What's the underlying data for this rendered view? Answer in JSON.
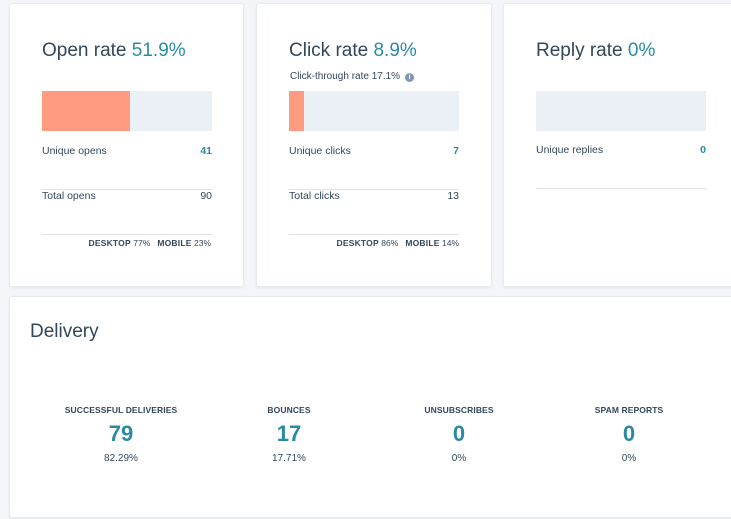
{
  "colors": {
    "accent": "#2b8aa3",
    "bar_fill": "#ff9b80",
    "bar_track": "#eaf0f6",
    "text": "#33475b"
  },
  "open_card": {
    "title": "Open rate",
    "rate": "51.9%",
    "bar_fraction": 0.519,
    "rows": [
      {
        "label": "Unique opens",
        "value": "41"
      },
      {
        "label": "Total opens",
        "value": "90"
      }
    ],
    "desktop_label": "DESKTOP",
    "desktop_value": "77%",
    "mobile_label": "MOBILE",
    "mobile_value": "23%"
  },
  "click_card": {
    "title": "Click rate",
    "rate": "8.9%",
    "subline": "Click-through rate 17.1%",
    "info_icon": "i",
    "bar_fraction": 0.089,
    "rows": [
      {
        "label": "Unique clicks",
        "value": "7"
      },
      {
        "label": "Total clicks",
        "value": "13"
      }
    ],
    "desktop_label": "DESKTOP",
    "desktop_value": "86%",
    "mobile_label": "MOBILE",
    "mobile_value": "14%"
  },
  "reply_card": {
    "title": "Reply rate",
    "rate": "0%",
    "bar_fraction": 0,
    "rows": [
      {
        "label": "Unique replies",
        "value": "0"
      }
    ]
  },
  "delivery": {
    "title": "Delivery",
    "stats": [
      {
        "label": "SUCCESSFUL DELIVERIES",
        "value": "79",
        "pct": "82.29%"
      },
      {
        "label": "BOUNCES",
        "value": "17",
        "pct": "17.71%"
      },
      {
        "label": "UNSUBSCRIBES",
        "value": "0",
        "pct": "0%"
      },
      {
        "label": "SPAM REPORTS",
        "value": "0",
        "pct": "0%"
      }
    ]
  }
}
